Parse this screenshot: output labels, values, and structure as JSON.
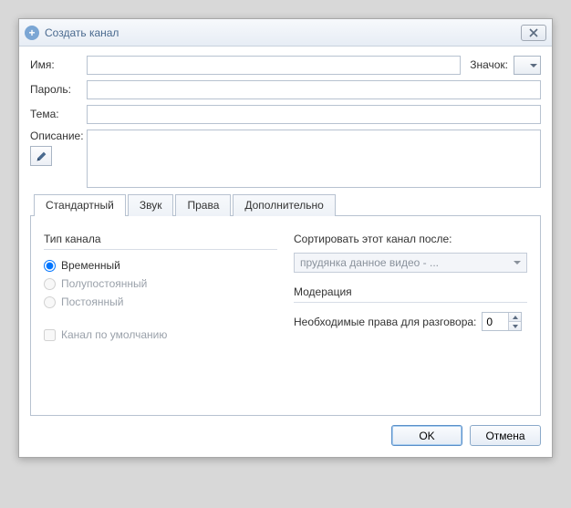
{
  "window": {
    "title": "Создать канал"
  },
  "form": {
    "name_label": "Имя:",
    "name_value": "",
    "icon_label": "Значок:",
    "password_label": "Пароль:",
    "password_value": "",
    "topic_label": "Тема:",
    "topic_value": "",
    "description_label": "Описание:",
    "description_value": ""
  },
  "tabs": [
    {
      "label": "Стандартный"
    },
    {
      "label": "Звук"
    },
    {
      "label": "Права"
    },
    {
      "label": "Дополнительно"
    }
  ],
  "standard": {
    "channel_type_title": "Тип канала",
    "type_temporary": "Временный",
    "type_semiperm": "Полупостоянный",
    "type_perm": "Постоянный",
    "default_channel": "Канал по умолчанию",
    "sort_label": "Сортировать этот канал после:",
    "sort_value": "прудянка данное видео - ...",
    "moderation_title": "Модерация",
    "talk_power_label": "Необходимые права для разговора:",
    "talk_power_value": "0"
  },
  "footer": {
    "ok": "OK",
    "cancel": "Отмена"
  }
}
